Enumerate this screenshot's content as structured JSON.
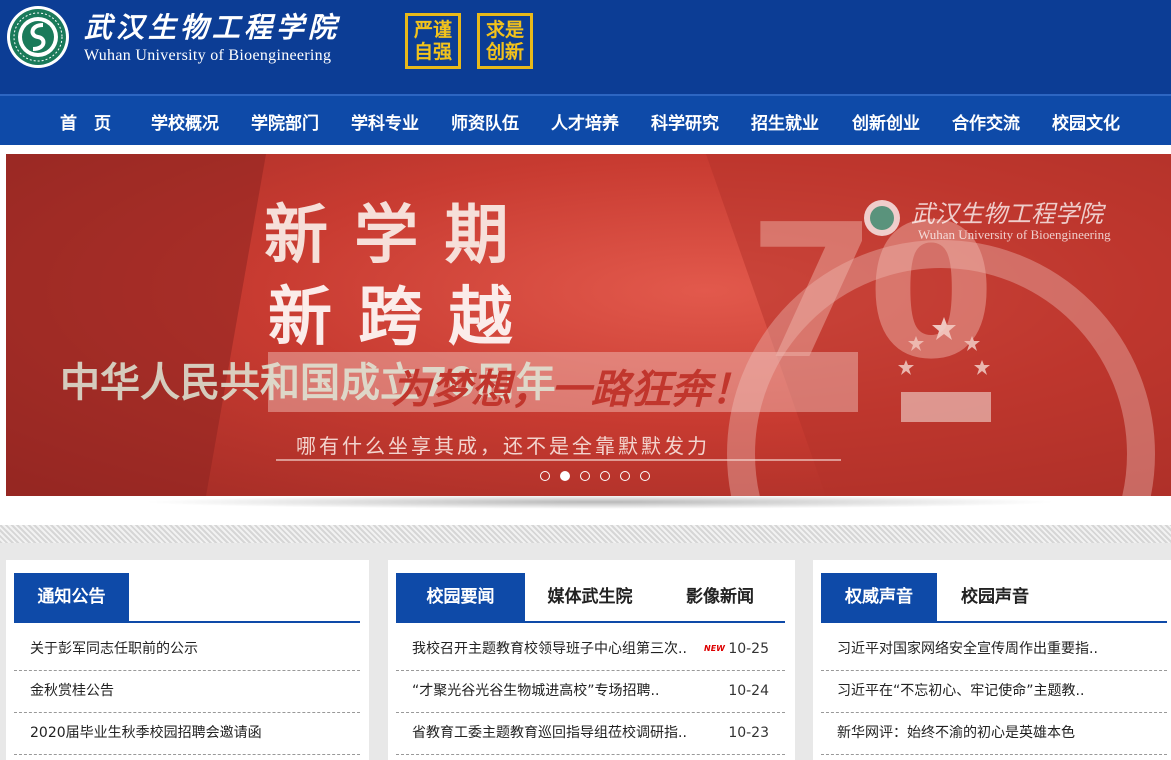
{
  "header": {
    "cn_name": "武汉生物工程学院",
    "en_name": "Wuhan University of Bioengineering",
    "motto": [
      {
        "line1": "严谨",
        "line2": "自强"
      },
      {
        "line1": "求是",
        "line2": "创新"
      }
    ],
    "logo_icon": "university-emblem-icon"
  },
  "nav": {
    "items": [
      "首　页",
      "学校概况",
      "学院部门",
      "学科专业",
      "师资队伍",
      "人才培养",
      "科学研究",
      "招生就业",
      "创新创业",
      "合作交流",
      "校园文化"
    ]
  },
  "banner": {
    "line1": "新 学 期",
    "line2": "新 跨 越",
    "line3": "中华人民共和国成立70周年",
    "line4": "为梦想，一路狂奔！",
    "line5": "哪有什么坐享其成，还不是全靠默默发力",
    "big_number": "70",
    "watermark_cn": "武汉生物工程学院",
    "watermark_en": "Wuhan University of Bioengineering",
    "slide_count": 6,
    "active_slide": 2
  },
  "panels": {
    "notice": {
      "tabs": [
        "通知公告"
      ],
      "items": [
        {
          "title": "关于彭军同志任职前的公示"
        },
        {
          "title": "金秋赏桂公告"
        },
        {
          "title": "2020届毕业生秋季校园招聘会邀请函"
        }
      ]
    },
    "news": {
      "tabs": [
        "校园要闻",
        "媒体武生院",
        "影像新闻"
      ],
      "new_badge": "NEW",
      "items": [
        {
          "title": "我校召开主题教育校领导班子中心组第三次..",
          "date": "10-25"
        },
        {
          "title": "“才聚光谷光谷生物城进高校”专场招聘..",
          "date": "10-24"
        },
        {
          "title": "省教育工委主题教育巡回指导组莅校调研指..",
          "date": "10-23"
        }
      ]
    },
    "voice": {
      "tabs": [
        "权威声音",
        "校园声音"
      ],
      "items": [
        {
          "title": "习近平对国家网络安全宣传周作出重要指.."
        },
        {
          "title": "习近平在“不忘初心、牢记使命”主题教.."
        },
        {
          "title": "新华网评：始终不渝的初心是英雄本色"
        }
      ]
    }
  },
  "colors": {
    "header_bg": "#0c3d95",
    "nav_bg": "#0e4aa8",
    "accent_gold": "#f2c21c",
    "banner_red": "#c83b31"
  }
}
